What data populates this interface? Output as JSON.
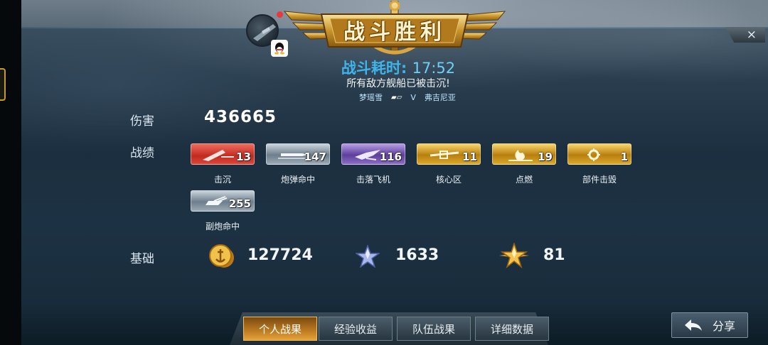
{
  "header": {
    "title": "战斗胜利",
    "close_icon": "×",
    "battle_time_label": "战斗耗时:",
    "battle_time_value": "17:52",
    "result_message": "所有敌方舰船已被击沉!",
    "player_name": "梦瑶雪",
    "versus": "V",
    "opponent_name": "弗吉尼亚"
  },
  "damage": {
    "label": "伤害",
    "value": "436665"
  },
  "achievements": {
    "label": "战绩",
    "items": [
      {
        "label": "击沉",
        "count": "13",
        "style": "red",
        "icon": "ship-sinking-icon"
      },
      {
        "label": "炮弹命中",
        "count": "147",
        "style": "gray",
        "icon": "shell-icon"
      },
      {
        "label": "击落飞机",
        "count": "116",
        "style": "purple",
        "icon": "plane-icon"
      },
      {
        "label": "核心区",
        "count": "11",
        "style": "gold",
        "icon": "core-icon"
      },
      {
        "label": "点燃",
        "count": "19",
        "style": "gold",
        "icon": "fire-icon"
      },
      {
        "label": "部件击毁",
        "count": "1",
        "style": "gold",
        "icon": "gear-icon"
      },
      {
        "label": "副炮命中",
        "count": "255",
        "style": "gray",
        "icon": "secondary-gun-icon"
      }
    ]
  },
  "base": {
    "label": "基础",
    "gold_value": "127724",
    "silver_star_value": "1633",
    "gold_star_value": "81"
  },
  "tabs": [
    {
      "label": "个人战果",
      "active": true
    },
    {
      "label": "经验收益",
      "active": false
    },
    {
      "label": "队伍战果",
      "active": false
    },
    {
      "label": "详细数据",
      "active": false
    }
  ],
  "share": {
    "label": "分享",
    "icon": "share-arrow-icon"
  }
}
